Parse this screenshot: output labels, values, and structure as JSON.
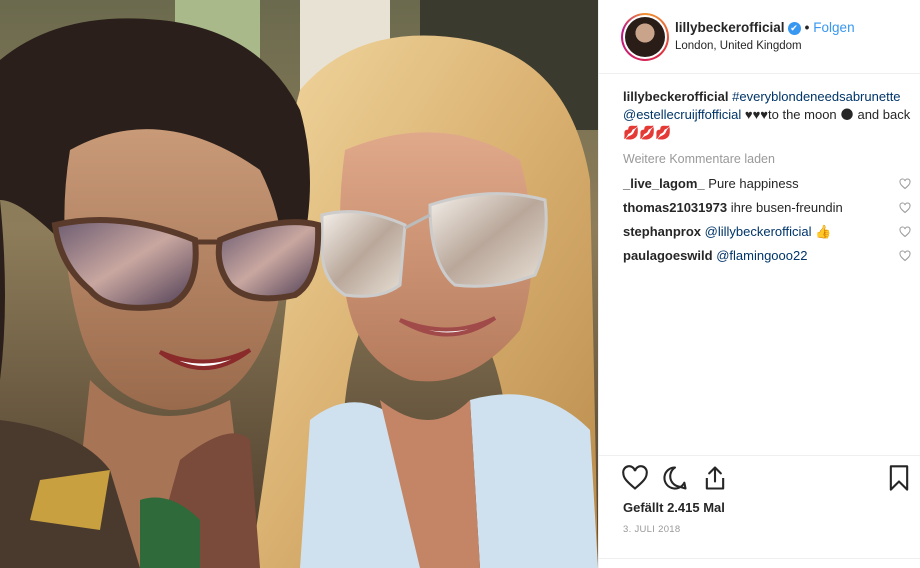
{
  "post": {
    "username": "lillybeckerofficial",
    "verified_mark": "✔",
    "separator": "•",
    "follow_label": "Folgen",
    "location": "London, United Kingdom",
    "caption_user": "lillybeckerofficial",
    "caption_hashtag": "#everyblondeneedsabrunette",
    "caption_mention": "@estellecruijffofficial",
    "caption_hearts": "♥♥♥",
    "caption_text": "to the moon",
    "caption_moon": "🌑",
    "caption_end": "and back",
    "caption_lips": "💋💋💋",
    "load_more_label": "Weitere Kommentare laden",
    "comments": [
      {
        "user": "_live_lagom_",
        "text": "Pure happiness",
        "mention": ""
      },
      {
        "user": "thomas21031973",
        "text": "ihre busen-freundin",
        "mention": ""
      },
      {
        "user": "stephanprox",
        "text": "👍",
        "mention": "@lillybeckerofficial"
      },
      {
        "user": "paulagoeswild",
        "text": "",
        "mention": "@flamingooo22"
      }
    ],
    "likes_label": "Gefällt 2.415 Mal",
    "date": "3. JULI 2018"
  },
  "icons": {
    "like": "heart-icon",
    "comment": "comment-icon",
    "share": "share-icon",
    "save": "bookmark-icon",
    "verified": "verified-badge-icon"
  },
  "colors": {
    "link": "#003569",
    "follow": "#3897f0",
    "muted": "#999999"
  }
}
